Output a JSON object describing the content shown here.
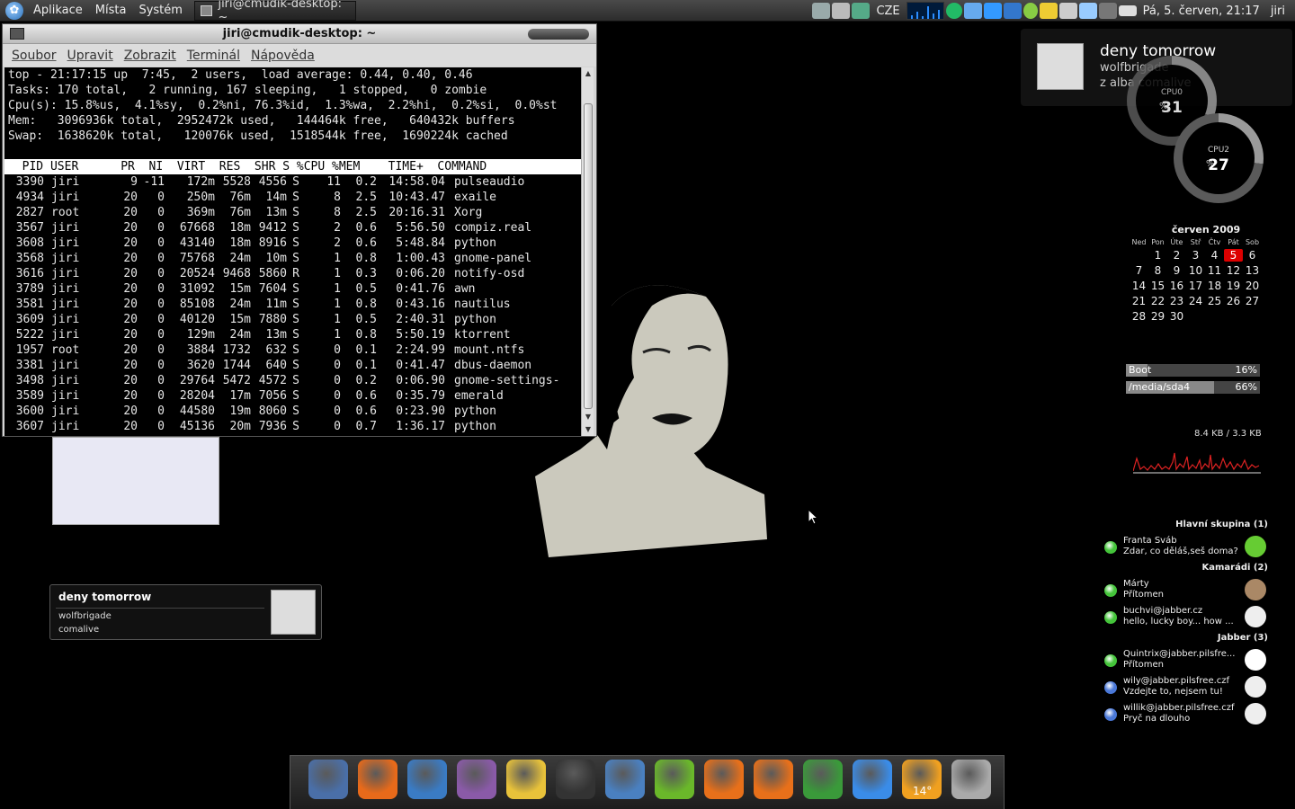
{
  "top_panel": {
    "menus": [
      "Aplikace",
      "Místa",
      "Systém"
    ],
    "task": "jiri@cmudik-desktop: ~",
    "keyboard_layout": "CZE",
    "datetime": "Pá,  5. červen, 21:17",
    "user": "jiri"
  },
  "terminal": {
    "title": "jiri@cmudik-desktop: ~",
    "menu": [
      "Soubor",
      "Upravit",
      "Zobrazit",
      "Terminál",
      "Nápověda"
    ],
    "summary": [
      "top - 21:17:15 up  7:45,  2 users,  load average: 0.44, 0.40, 0.46",
      "Tasks: 170 total,   2 running, 167 sleeping,   1 stopped,   0 zombie",
      "Cpu(s): 15.8%us,  4.1%sy,  0.2%ni, 76.3%id,  1.3%wa,  2.2%hi,  0.2%si,  0.0%st",
      "Mem:   3096936k total,  2952472k used,   144464k free,   640432k buffers",
      "Swap:  1638620k total,   120076k used,  1518544k free,  1690224k cached"
    ],
    "header": "  PID USER      PR  NI  VIRT  RES  SHR S %CPU %MEM    TIME+  COMMAND",
    "processes": [
      [
        "3390",
        "jiri",
        "9",
        "-11",
        "172m",
        "5528",
        "4556",
        "S",
        "11",
        "0.2",
        "14:58.04",
        "pulseaudio"
      ],
      [
        "4934",
        "jiri",
        "20",
        "0",
        "250m",
        "76m",
        "14m",
        "S",
        "8",
        "2.5",
        "10:43.47",
        "exaile"
      ],
      [
        "2827",
        "root",
        "20",
        "0",
        "369m",
        "76m",
        "13m",
        "S",
        "8",
        "2.5",
        "20:16.31",
        "Xorg"
      ],
      [
        "3567",
        "jiri",
        "20",
        "0",
        "67668",
        "18m",
        "9412",
        "S",
        "2",
        "0.6",
        "5:56.50",
        "compiz.real"
      ],
      [
        "3608",
        "jiri",
        "20",
        "0",
        "43140",
        "18m",
        "8916",
        "S",
        "2",
        "0.6",
        "5:48.84",
        "python"
      ],
      [
        "3568",
        "jiri",
        "20",
        "0",
        "75768",
        "24m",
        "10m",
        "S",
        "1",
        "0.8",
        "1:00.43",
        "gnome-panel"
      ],
      [
        "3616",
        "jiri",
        "20",
        "0",
        "20524",
        "9468",
        "5860",
        "R",
        "1",
        "0.3",
        "0:06.20",
        "notify-osd"
      ],
      [
        "3789",
        "jiri",
        "20",
        "0",
        "31092",
        "15m",
        "7604",
        "S",
        "1",
        "0.5",
        "0:41.76",
        "awn"
      ],
      [
        "3581",
        "jiri",
        "20",
        "0",
        "85108",
        "24m",
        "11m",
        "S",
        "1",
        "0.8",
        "0:43.16",
        "nautilus"
      ],
      [
        "3609",
        "jiri",
        "20",
        "0",
        "40120",
        "15m",
        "7880",
        "S",
        "1",
        "0.5",
        "2:40.31",
        "python"
      ],
      [
        "5222",
        "jiri",
        "20",
        "0",
        "129m",
        "24m",
        "13m",
        "S",
        "1",
        "0.8",
        "5:50.19",
        "ktorrent"
      ],
      [
        "1957",
        "root",
        "20",
        "0",
        "3884",
        "1732",
        "632",
        "S",
        "0",
        "0.1",
        "2:24.99",
        "mount.ntfs"
      ],
      [
        "3381",
        "jiri",
        "20",
        "0",
        "3620",
        "1744",
        "640",
        "S",
        "0",
        "0.1",
        "0:41.47",
        "dbus-daemon"
      ],
      [
        "3498",
        "jiri",
        "20",
        "0",
        "29764",
        "5472",
        "4572",
        "S",
        "0",
        "0.2",
        "0:06.90",
        "gnome-settings-"
      ],
      [
        "3589",
        "jiri",
        "20",
        "0",
        "28204",
        "17m",
        "7056",
        "S",
        "0",
        "0.6",
        "0:35.79",
        "emerald"
      ],
      [
        "3600",
        "jiri",
        "20",
        "0",
        "44580",
        "19m",
        "8060",
        "S",
        "0",
        "0.6",
        "0:23.90",
        "python"
      ],
      [
        "3607",
        "jiri",
        "20",
        "0",
        "45136",
        "20m",
        "7936",
        "S",
        "0",
        "0.7",
        "1:36.17",
        "python"
      ]
    ]
  },
  "notification": {
    "title": "deny tomorrow",
    "artist": "wolfbrigade",
    "album": "z alba comalive"
  },
  "cpu": [
    {
      "label": "CPU0",
      "value": "31",
      "fraction": 0.31
    },
    {
      "label": "CPU2",
      "value": "27",
      "fraction": 0.27
    }
  ],
  "calendar": {
    "title": "červen 2009",
    "weekdays": [
      "Ned",
      "Pon",
      "Úte",
      "Stř",
      "Čtv",
      "Pát",
      "Sob"
    ],
    "days": [
      "",
      "1",
      "2",
      "3",
      "4",
      "5",
      "6",
      "7",
      "8",
      "9",
      "10",
      "11",
      "12",
      "13",
      "14",
      "15",
      "16",
      "17",
      "18",
      "19",
      "20",
      "21",
      "22",
      "23",
      "24",
      "25",
      "26",
      "27",
      "28",
      "29",
      "30"
    ],
    "today": "5"
  },
  "disks": [
    {
      "label": "Boot",
      "value": "16%",
      "fraction": 0.16
    },
    {
      "label": "/media/sda4",
      "value": "66%",
      "fraction": 0.66
    }
  ],
  "network": {
    "label": "8.4 KB / 3.3 KB"
  },
  "contacts": {
    "groups": [
      {
        "name": "Hlavní skupina (1)",
        "items": [
          {
            "name": "Franta Šváb",
            "msg": "Zdar, co děláš,seš doma?",
            "status": "#44c43a"
          }
        ]
      },
      {
        "name": "Kamarádi (2)",
        "items": [
          {
            "name": "Márty",
            "msg": "Přítomen",
            "status": "#44c43a"
          },
          {
            "name": "buchvi@jabber.cz",
            "msg": "hello, lucky boy... how ...",
            "status": "#44c43a"
          }
        ]
      },
      {
        "name": "Jabber (3)",
        "items": [
          {
            "name": "Quintrix@jabber.pilsfre...",
            "msg": "Přítomen",
            "status": "#44c43a"
          },
          {
            "name": "wily@jabber.pilsfree.czf",
            "msg": "Vzdejte to, nejsem tu!",
            "status": "#4a78d8"
          },
          {
            "name": "willik@jabber.pilsfree.czf",
            "msg": "Pryč na dlouho",
            "status": "#4a78d8"
          }
        ]
      }
    ]
  },
  "now_playing": {
    "title": "deny tomorrow",
    "artist": "wolfbrigade",
    "album": "comalive"
  },
  "dock": {
    "weather_temp": "14°",
    "icons": [
      "floppy-icon",
      "firefox-icon",
      "thunderbird-icon",
      "pidgin-icon",
      "penguin-icon",
      "terminal-icon",
      "cursor-icon",
      "nvidia-icon",
      "rss-icon",
      "player-icon",
      "gentoo-icon",
      "download-icon",
      "weather-icon",
      "trash-icon"
    ]
  }
}
